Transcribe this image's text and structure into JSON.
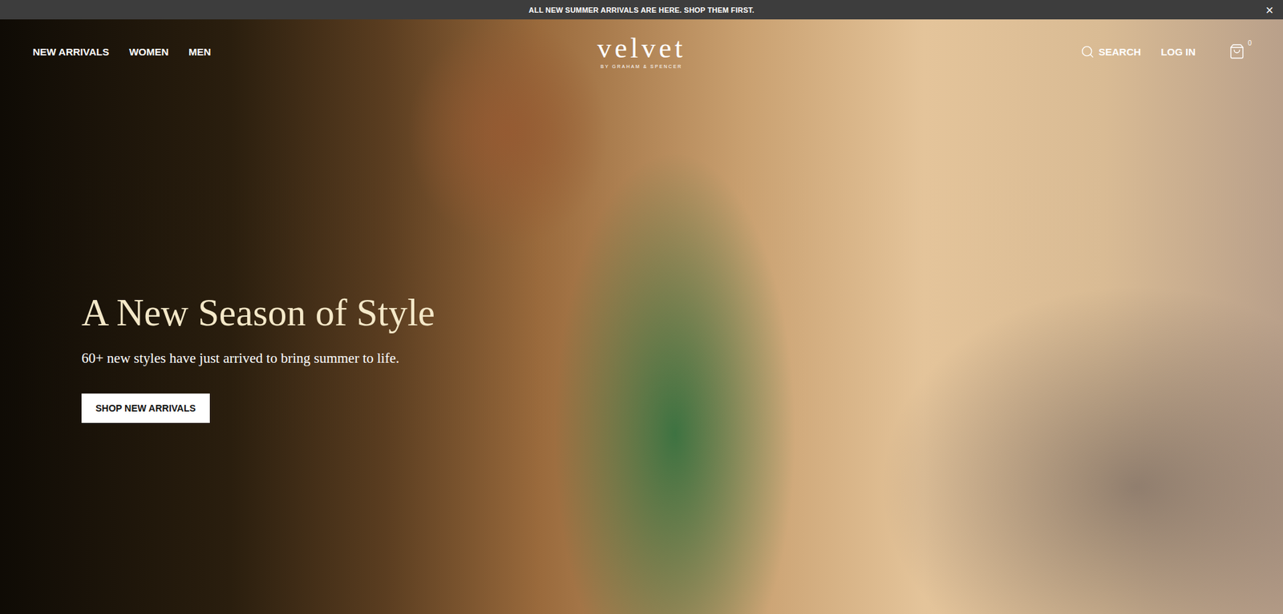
{
  "announcement": {
    "text": "ALL NEW SUMMER ARRIVALS ARE HERE. SHOP THEM FIRST.",
    "close": "×"
  },
  "nav": {
    "links": [
      {
        "label": "NEW ARRIVALS"
      },
      {
        "label": "WOMEN"
      },
      {
        "label": "MEN"
      }
    ],
    "logo": {
      "name": "velvet",
      "tagline": "BY GRAHAM & SPENCER"
    },
    "search": "SEARCH",
    "login": "LOG IN",
    "cart_count": "0"
  },
  "hero": {
    "title": "A New Season of Style",
    "subtitle": "60+ new styles have just arrived to bring summer to life.",
    "button": "SHOP NEW ARRIVALS"
  }
}
